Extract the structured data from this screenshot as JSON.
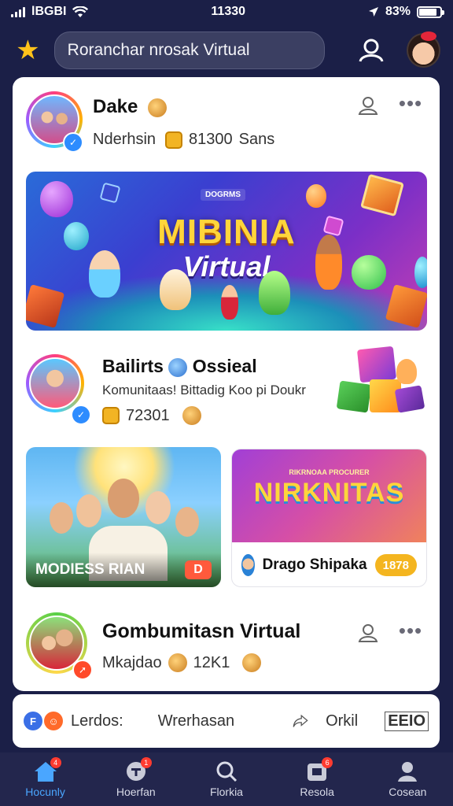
{
  "status_bar": {
    "carrier": "lBGBI",
    "time": "11330",
    "battery": "83%",
    "battery_level": 0.83
  },
  "header": {
    "search_placeholder": "Roranchar nrosak Virtual"
  },
  "posts": [
    {
      "name": "Dake",
      "meta_text": "Nderhsin",
      "stat": "81300",
      "stat_suffix": "Sans"
    },
    {
      "banner_brand": "DOGRMS",
      "banner_title": "MIBINIA",
      "banner_subtitle": "Virtual"
    },
    {
      "name": "Bailirts",
      "name_suffix": "Ossieal",
      "description": "Komunitaas! Bittadig Koo pi Doukr",
      "stat": "72301"
    },
    {
      "name": "Gombumitasn Virtual",
      "meta_text": "Mkajdao",
      "stat": "12K1"
    }
  ],
  "tiles": {
    "left_caption": "MODIESS RIAN",
    "left_badge": "D",
    "right_art_subtitle": "RIKRNOAA PROCURER",
    "right_art_title": "NIRKNITAS",
    "right_name": "Drago Shipaka",
    "right_pill": "1878"
  },
  "action_bar": {
    "mini_icon_1": "F",
    "label_1": "Lerdos:",
    "label_2": "Wrerhasan",
    "count": "Orkil",
    "last": "EEIO"
  },
  "tabs": [
    {
      "label": "Hocunly",
      "icon": "home-icon",
      "badge": "4"
    },
    {
      "label": "Hoerfan",
      "icon": "messages-icon",
      "badge": "1"
    },
    {
      "label": "Florkia",
      "icon": "search-icon"
    },
    {
      "label": "Resola",
      "icon": "inbox-icon",
      "badge": "6"
    },
    {
      "label": "Cosean",
      "icon": "profile-icon"
    }
  ],
  "colors": {
    "background": "#1b1f47",
    "accent": "#4aa6ff",
    "banner_title": "#ffd53b",
    "pill": "#f4b51f"
  }
}
